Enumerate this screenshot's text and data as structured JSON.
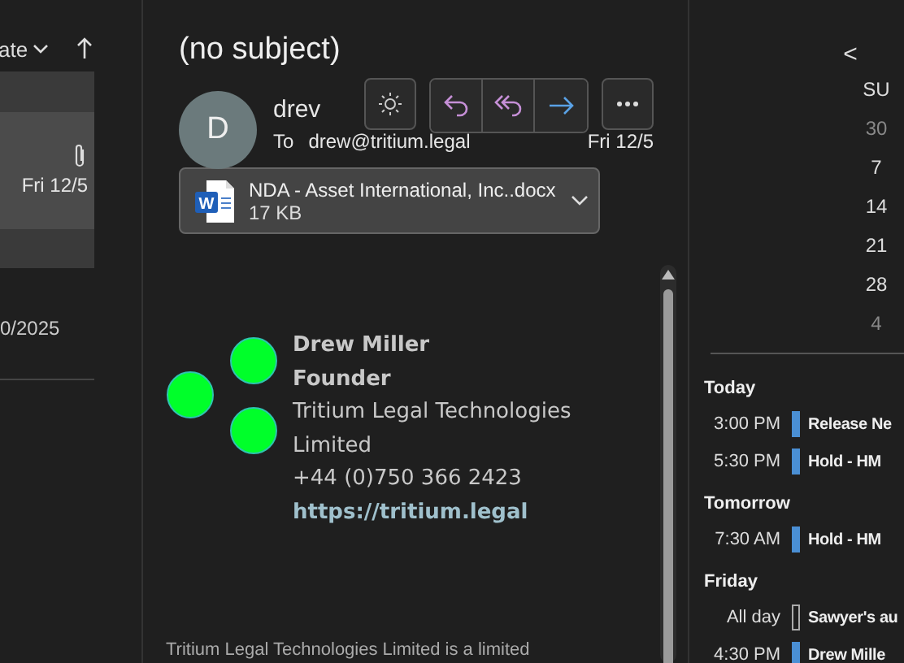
{
  "message_list": {
    "sort_label": "ate",
    "selected_message": {
      "date": "Fri 12/5",
      "has_attachment": true
    },
    "other_message": {
      "date": "0/2025"
    }
  },
  "reading_pane": {
    "subject": "(no subject)",
    "avatar_initial": "D",
    "sender": "drev",
    "to_label": "To",
    "recipient": "drew@tritium.legal",
    "date": "Fri 12/5",
    "attachment": {
      "file_badge": "W",
      "name": "NDA - Asset International, Inc..docx",
      "size": "17 KB"
    },
    "signature": {
      "name": "Drew Miller",
      "title": "Founder",
      "company": "Tritium Legal Technologies Limited",
      "phone": "+44 (0)750 366 2423",
      "link": "https://tritium.legal"
    },
    "footer_text": "Tritium Legal Technologies Limited is a limited"
  },
  "calendar": {
    "nav": "<",
    "weekday": "SU",
    "days": [
      {
        "label": "30",
        "other_month": true
      },
      {
        "label": "7",
        "other_month": false
      },
      {
        "label": "14",
        "other_month": false
      },
      {
        "label": "21",
        "other_month": false
      },
      {
        "label": "28",
        "other_month": false
      },
      {
        "label": "4",
        "other_month": true
      }
    ],
    "agenda": [
      {
        "day": "Today",
        "events": [
          {
            "time": "3:00 PM",
            "title": "Release Ne",
            "kind": "busy"
          },
          {
            "time": "5:30 PM",
            "title": "Hold - HM",
            "kind": "busy"
          }
        ]
      },
      {
        "day": "Tomorrow",
        "events": [
          {
            "time": "7:30 AM",
            "title": "Hold - HM",
            "kind": "busy"
          }
        ]
      },
      {
        "day": "Friday",
        "events": [
          {
            "time": "All day",
            "title": "Sawyer's au",
            "kind": "free"
          },
          {
            "time": "4:30 PM",
            "title": "Drew Mille",
            "kind": "busy"
          }
        ]
      }
    ]
  }
}
